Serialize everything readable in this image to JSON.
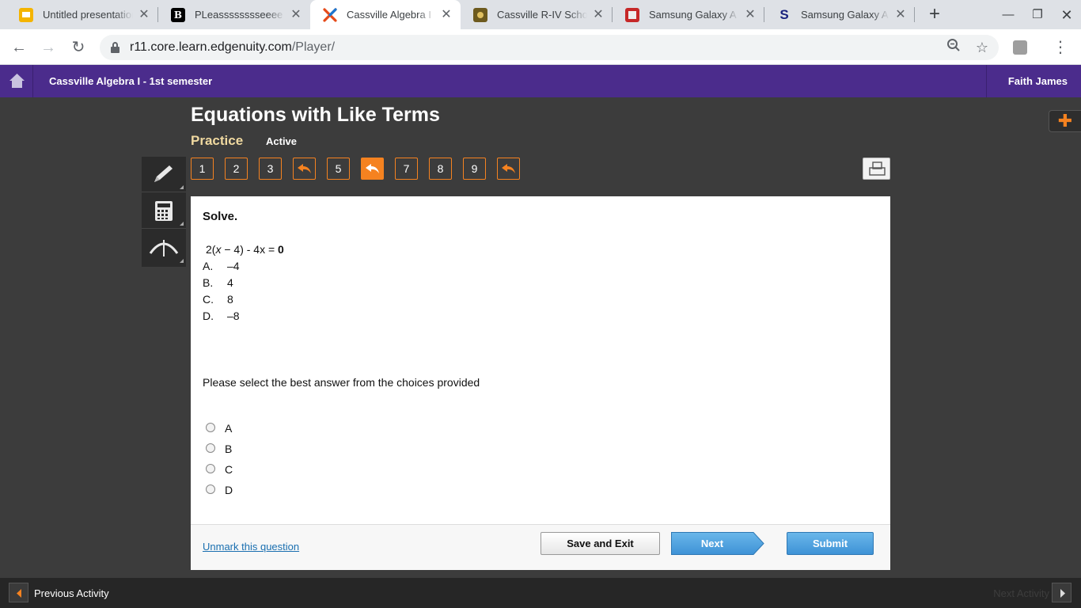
{
  "browser": {
    "tabs": [
      {
        "title": "Untitled presentation",
        "icon": "slides-icon",
        "color": "#f4b400"
      },
      {
        "title": "PLeasssssssseeee",
        "icon": "brainly-icon",
        "color": "#000000"
      },
      {
        "title": "Cassville Algebra I",
        "icon": "edgenuity-icon",
        "color": "#e64a19"
      },
      {
        "title": "Cassville R-IV School",
        "icon": "school-icon",
        "color": "#6d5a1e"
      },
      {
        "title": "Samsung Galaxy A",
        "icon": "samsung-icon",
        "color": "#c62828"
      },
      {
        "title": "Samsung Galaxy A",
        "icon": "s-icon",
        "color": "#1a237e"
      }
    ],
    "url_host": "r11.core.learn.edgenuity.com",
    "url_path": "/Player/"
  },
  "app": {
    "course_title": "Cassville Algebra I - 1st semester",
    "user_name": "Faith James",
    "brand_color": "#4b2c8c",
    "accent_color": "#f58220"
  },
  "activity": {
    "title": "Equations with Like Terms",
    "type": "Practice",
    "status": "Active"
  },
  "question_nav": [
    {
      "label": "1",
      "kind": "number"
    },
    {
      "label": "2",
      "kind": "number"
    },
    {
      "label": "3",
      "kind": "number"
    },
    {
      "label": "",
      "kind": "marked"
    },
    {
      "label": "5",
      "kind": "number"
    },
    {
      "label": "",
      "kind": "current-marked"
    },
    {
      "label": "7",
      "kind": "number"
    },
    {
      "label": "8",
      "kind": "number"
    },
    {
      "label": "9",
      "kind": "number"
    },
    {
      "label": "",
      "kind": "marked"
    }
  ],
  "tools": [
    "pencil-icon",
    "calculator-icon",
    "graph-icon"
  ],
  "question": {
    "prompt": "Solve.",
    "equation": {
      "prefix": "2(",
      "var": "x",
      "mid": " − 4) - 4x = ",
      "rhs": "0"
    },
    "choices": [
      {
        "letter": "A.",
        "value": "–4"
      },
      {
        "letter": "B.",
        "value": "4"
      },
      {
        "letter": "C.",
        "value": "8"
      },
      {
        "letter": "D.",
        "value": "–8"
      }
    ],
    "instruction": "Please select the best answer from the choices provided",
    "options": [
      "A",
      "B",
      "C",
      "D"
    ]
  },
  "footer": {
    "unmark": "Unmark this question",
    "save": "Save and Exit",
    "next": "Next",
    "submit": "Submit"
  },
  "bottom_nav": {
    "previous": "Previous Activity",
    "next": "Next Activity"
  }
}
